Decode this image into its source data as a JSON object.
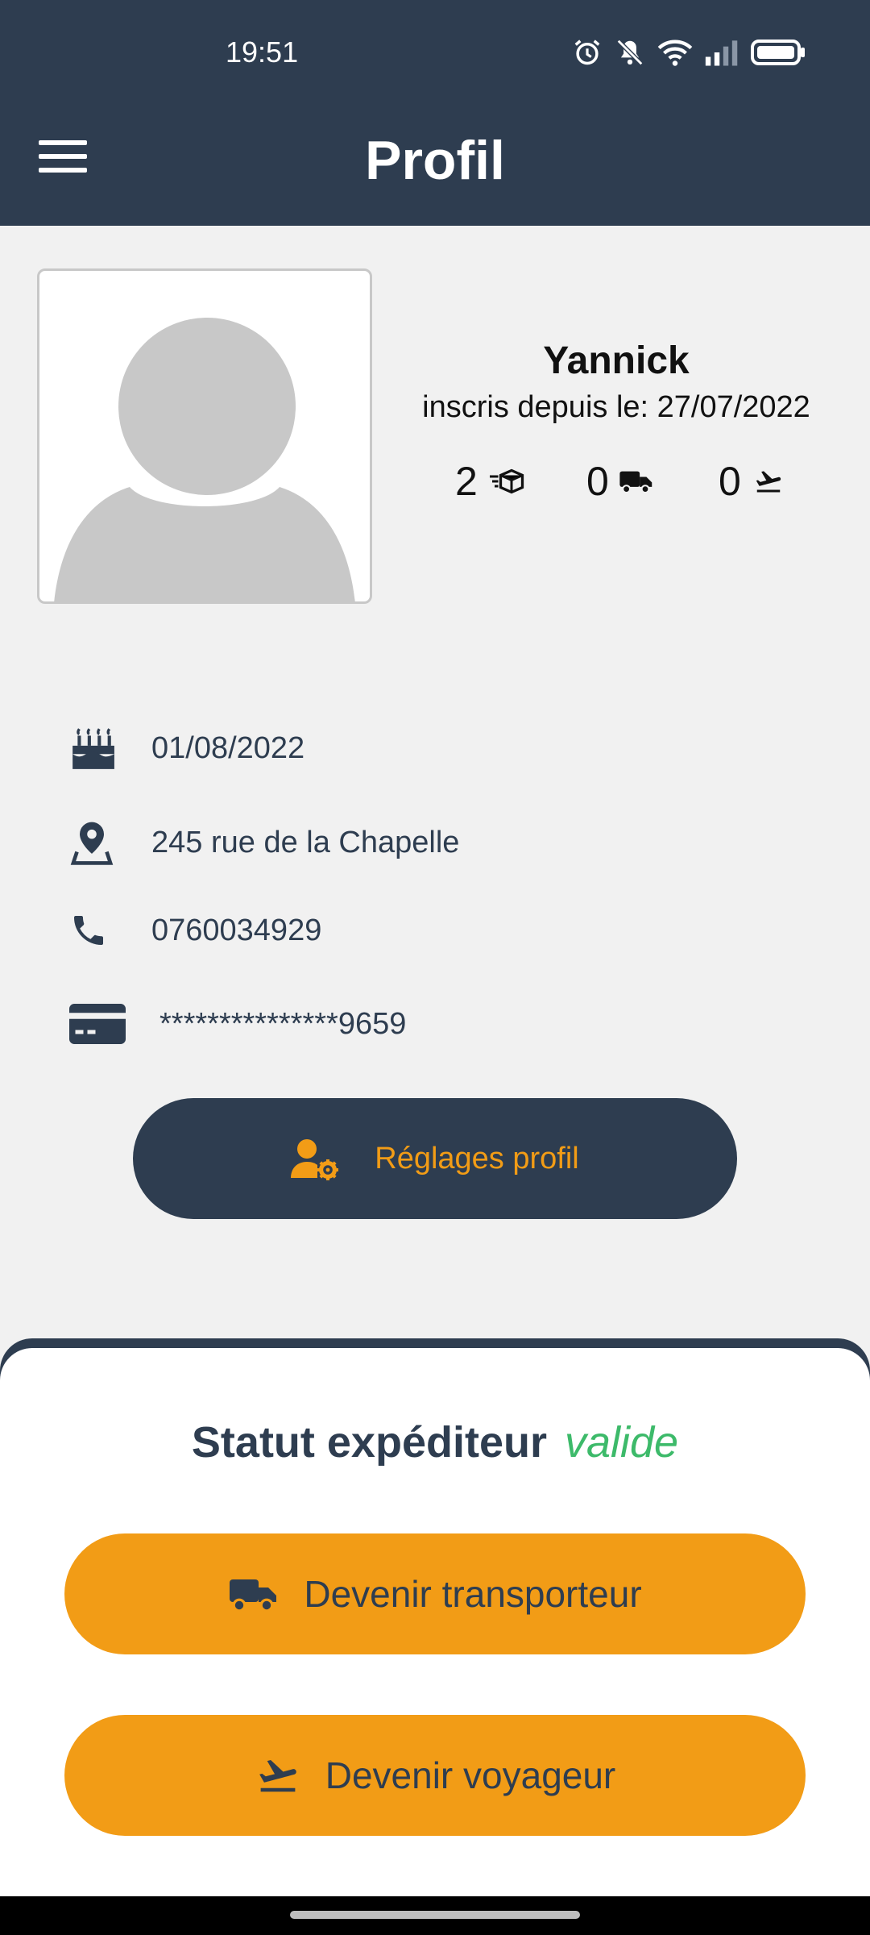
{
  "status_bar": {
    "time": "19:51"
  },
  "header": {
    "title": "Profil"
  },
  "profile": {
    "name": "Yannick",
    "member_since": "inscris depuis le: 27/07/2022",
    "stats": [
      {
        "value": "2",
        "icon": "package-fast-icon"
      },
      {
        "value": "0",
        "icon": "truck-icon"
      },
      {
        "value": "0",
        "icon": "plane-takeoff-icon"
      }
    ]
  },
  "info": {
    "birthday": "01/08/2022",
    "address": "245 rue de la Chapelle",
    "phone": "0760034929",
    "card": "***************9659"
  },
  "settings_button": {
    "label": "Réglages profil"
  },
  "status_sheet": {
    "label": "Statut expéditeur",
    "value": "valide",
    "actions": [
      {
        "label": "Devenir transporteur",
        "icon": "truck-icon"
      },
      {
        "label": "Devenir voyageur",
        "icon": "plane-takeoff-icon"
      }
    ]
  },
  "colors": {
    "primary": "#2e3d50",
    "accent": "#f29c16",
    "valid": "#3dba6a",
    "background": "#f1f1f1"
  }
}
